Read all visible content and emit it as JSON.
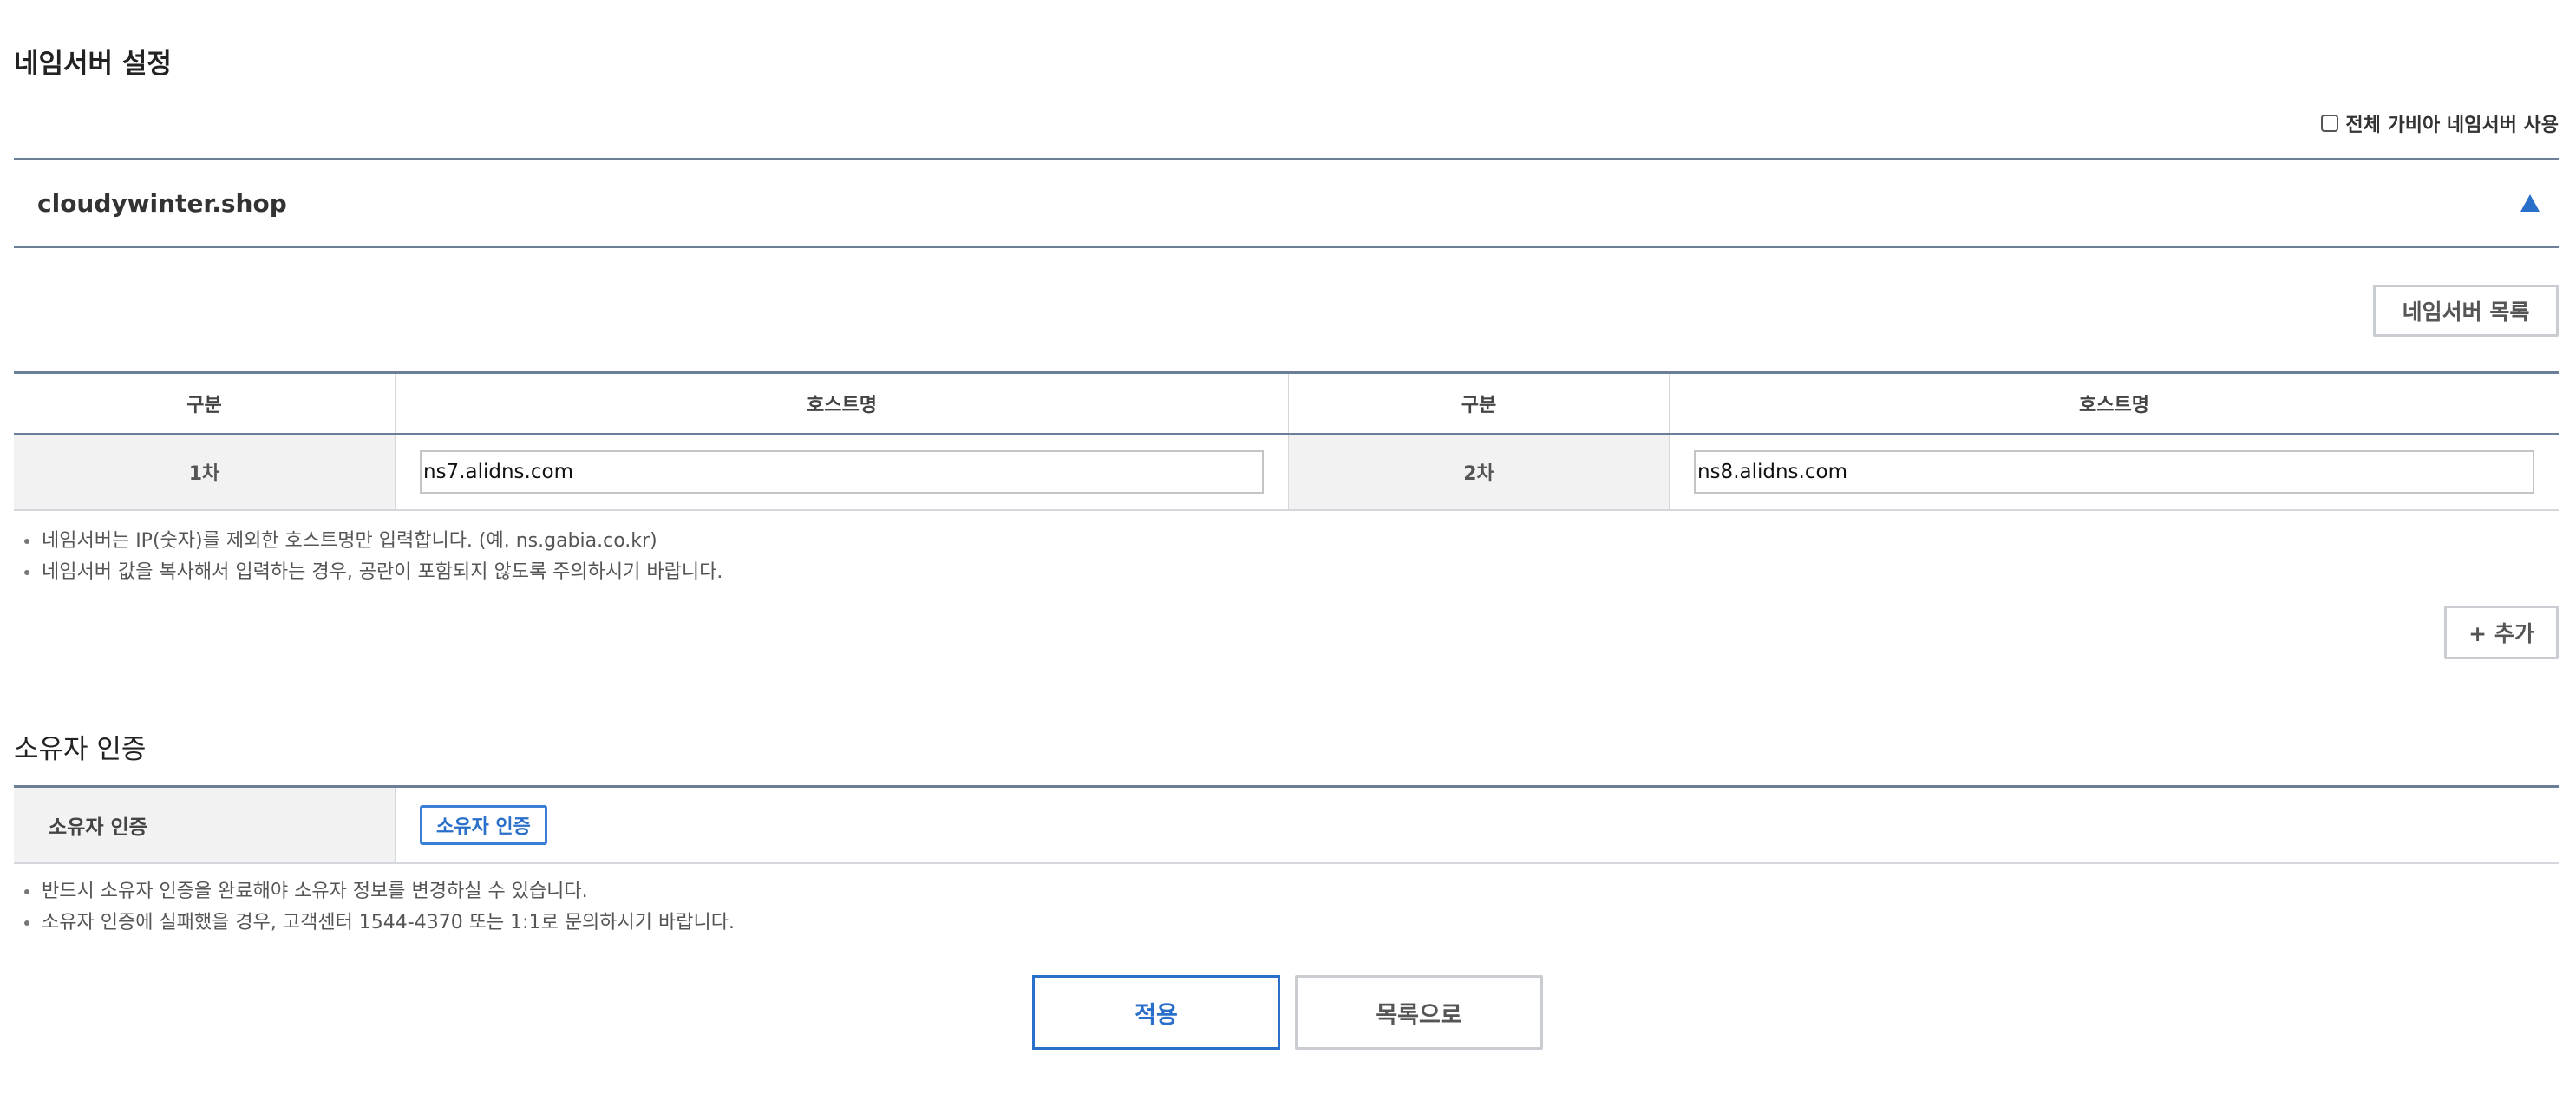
{
  "page": {
    "title": "네임서버 설정",
    "all_gabia_ns_label": "전체 가비아 네임서버 사용",
    "domain": "cloudywinter.shop",
    "ns_list_button": "네임서버 목록",
    "add_button": "+ 추가"
  },
  "ns_table": {
    "headers": [
      "구분",
      "호스트명",
      "구분",
      "호스트명"
    ],
    "rows": [
      {
        "label1": "1차",
        "host1": "ns7.alidns.com",
        "label2": "2차",
        "host2": "ns8.alidns.com"
      }
    ]
  },
  "ns_notes": [
    "네임서버는 IP(숫자)를 제외한 호스트명만 입력합니다. (예. ns.gabia.co.kr)",
    "네임서버 값을 복사해서 입력하는 경우, 공란이 포함되지 않도록 주의하시기 바랍니다."
  ],
  "owner": {
    "section_title": "소유자 인증",
    "row_label": "소유자 인증",
    "verify_button": "소유자 인증",
    "notes": [
      "반드시 소유자 인증을 완료해야 소유자 정보를 변경하실 수 있습니다.",
      "소유자 인증에 실패했을 경우, 고객센터 1544-4370 또는 1:1로 문의하시기 바랍니다."
    ]
  },
  "actions": {
    "apply": "적용",
    "back_to_list": "목록으로"
  },
  "colors": {
    "accent": "#2a6fc9",
    "table_rule": "#6b7f99",
    "label_bg": "#f2f2f2"
  }
}
